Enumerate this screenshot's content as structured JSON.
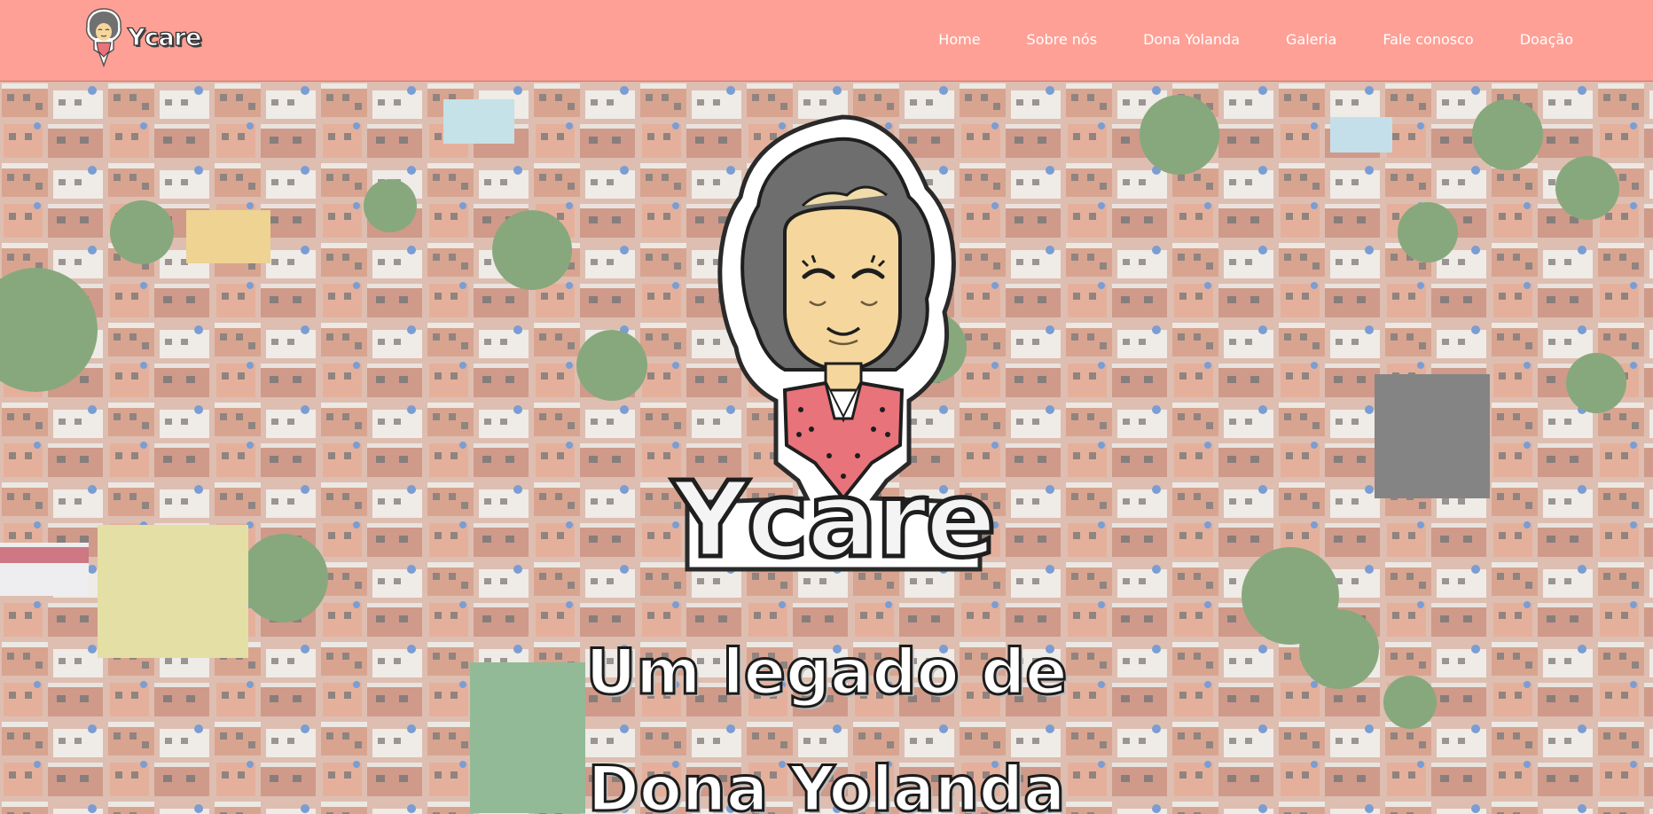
{
  "navbar": {
    "brand_name": "Ycare",
    "links": [
      {
        "label": "Home"
      },
      {
        "label": "Sobre nós"
      },
      {
        "label": "Dona Yolanda"
      },
      {
        "label": "Galeria"
      },
      {
        "label": "Fale conosco"
      },
      {
        "label": "Doação"
      }
    ]
  },
  "hero": {
    "logo_text": "Ycare",
    "title_line1": "Um legado de",
    "title_line2": "Dona Yolanda"
  },
  "colors": {
    "navbar": "#ffa096",
    "nav_text": "#ffffff",
    "brick": "#c9765c",
    "hair": "#6f6f6f",
    "skin": "#f5d79e",
    "shirt": "#e8737a"
  },
  "icons": {
    "brand": "grandma-mascot-icon",
    "hero": "grandma-mascot-illustration"
  }
}
